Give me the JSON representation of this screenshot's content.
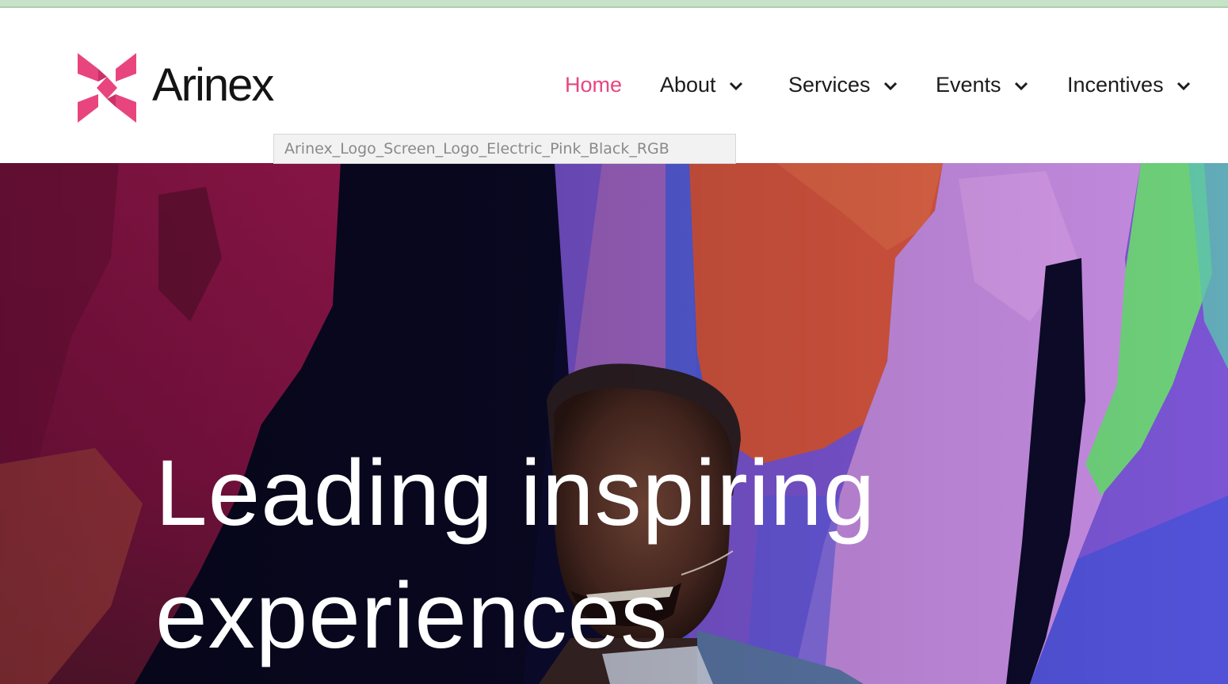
{
  "browser": {
    "tooltip_text": "Arinex_Logo_Screen_Logo_Electric_Pink_Black_RGB"
  },
  "brand": {
    "name": "Arinex",
    "logo_icon": "x-star-mark-icon",
    "accent_color": "#e8457f",
    "text_color": "#141414"
  },
  "nav": {
    "items": [
      {
        "label": "Home",
        "active": true,
        "dropdown": false
      },
      {
        "label": "About",
        "active": false,
        "dropdown": true
      },
      {
        "label": "Services",
        "active": false,
        "dropdown": true
      },
      {
        "label": "Events",
        "active": false,
        "dropdown": true
      },
      {
        "label": "Incentives",
        "active": false,
        "dropdown": true
      }
    ],
    "dropdown_icon": "chevron-down-icon"
  },
  "hero": {
    "title_line1": "Leading inspiring",
    "title_line2": "experiences",
    "background": "speaker-on-stage-photo",
    "text_color": "#ffffff"
  }
}
